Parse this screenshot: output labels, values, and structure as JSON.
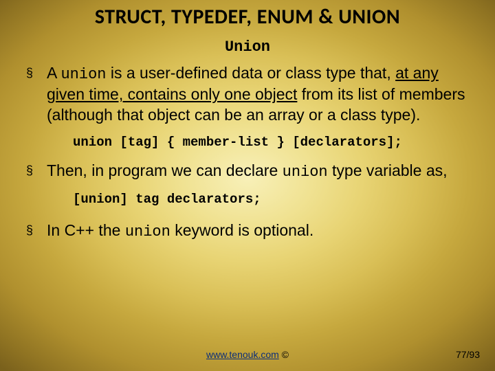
{
  "title": "STRUCT, TYPEDEF, ENUM & UNION",
  "subtitle": "Union",
  "bullets": {
    "b1_pre": "A ",
    "b1_code": "union",
    "b1_mid": " is a user-defined data or class type that, ",
    "b1_under": "at any given time, contains only one object",
    "b1_post": " from its list of members (although that object can be an array or a class type).",
    "code1": "union [tag] { member-list } [declarators];",
    "b2_pre": "Then, in program we can declare ",
    "b2_code": "union",
    "b2_post": " type variable as,",
    "code2": "[union] tag declarators;",
    "b3_pre": "In C++ the ",
    "b3_code": "union",
    "b3_post": " keyword is optional."
  },
  "footer": {
    "link_text": "www.tenouk.com",
    "link_href": "http://www.tenouk.com",
    "copyright": " ©"
  },
  "page": "77/93"
}
